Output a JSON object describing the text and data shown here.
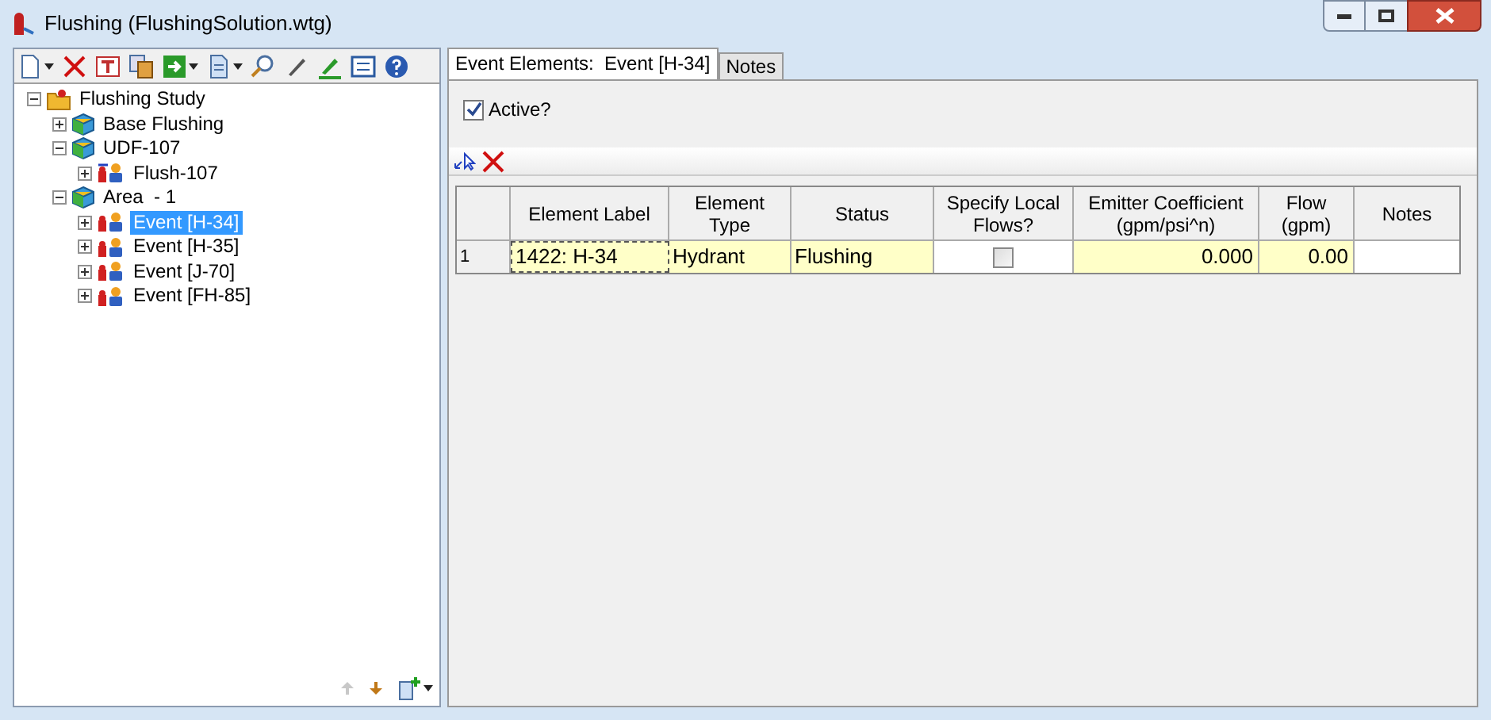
{
  "window": {
    "title": "Flushing (FlushingSolution.wtg)"
  },
  "tree": [
    {
      "label": "Flushing Study",
      "kind": "study",
      "expanded": true,
      "selected": false,
      "children": [
        {
          "label": "Base Flushing",
          "kind": "scenario",
          "expanded": false,
          "selected": false
        },
        {
          "label": "UDF-107",
          "kind": "scenario",
          "expanded": true,
          "selected": false,
          "children": [
            {
              "label": "Flush-107",
              "kind": "flush",
              "expanded": false,
              "selected": false
            }
          ]
        },
        {
          "label": "Area  - 1",
          "kind": "scenario",
          "expanded": true,
          "selected": false,
          "children": [
            {
              "label": "Event [H-34]",
              "kind": "event",
              "expanded": false,
              "selected": true
            },
            {
              "label": "Event [H-35]",
              "kind": "event",
              "expanded": false,
              "selected": false
            },
            {
              "label": "Event [J-70]",
              "kind": "event",
              "expanded": false,
              "selected": false
            },
            {
              "label": "Event [FH-85]",
              "kind": "event",
              "expanded": false,
              "selected": false
            }
          ]
        }
      ]
    }
  ],
  "tabs": [
    {
      "label": "Event Elements:  Event [H-34]",
      "selected": true
    },
    {
      "label": "Notes",
      "selected": false
    }
  ],
  "active": {
    "label": "Active?",
    "checked": true
  },
  "table": {
    "columns": [
      "Element Label",
      "Element Type",
      "Status",
      "Specify Local Flows?",
      "Emitter Coefficient (gpm/psi^n)",
      "Flow (gpm)",
      "Notes"
    ],
    "rows": [
      {
        "number": "1",
        "element_label": "1422: H-34",
        "element_type": "Hydrant",
        "status": "Flushing",
        "specify_local_flows": false,
        "emitter_coefficient": "0.000",
        "flow": "0.00"
      }
    ]
  }
}
